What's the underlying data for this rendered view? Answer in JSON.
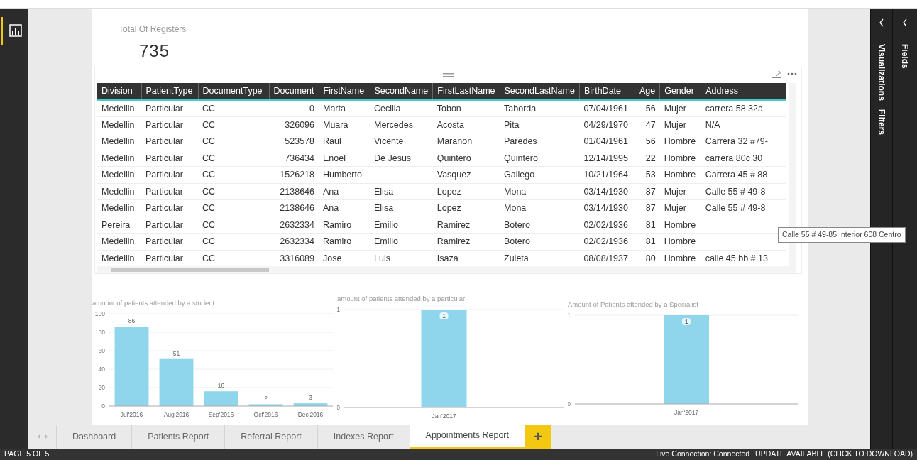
{
  "card": {
    "label": "Total Of Registers",
    "value": "735"
  },
  "table": {
    "columns": [
      "Division",
      "PatientType",
      "DocumentType",
      "Document",
      "FirstName",
      "SecondName",
      "FirstLastName",
      "SecondLastName",
      "BirthDate",
      "Age",
      "Gender",
      "Address"
    ],
    "rows": [
      [
        "Medellin",
        "Particular",
        "CC",
        "0",
        "Marta",
        "Cecilia",
        "Tobon",
        "Taborda",
        "07/04/1961",
        "56",
        "Mujer",
        "carrera 58 32a"
      ],
      [
        "Medellin",
        "Particular",
        "CC",
        "326096",
        "Muara",
        "Mercedes",
        "Acosta",
        "Pita",
        "04/29/1970",
        "47",
        "Mujer",
        "N/A"
      ],
      [
        "Medellin",
        "Particular",
        "CC",
        "523578",
        "Raul",
        "Vicente",
        "Marañon",
        "Paredes",
        "01/04/1961",
        "56",
        "Hombre",
        "Carrera 32 #79-"
      ],
      [
        "Medellin",
        "Particular",
        "CC",
        "736434",
        "Enoel",
        "De Jesus",
        "Quintero",
        "Quintero",
        "12/14/1995",
        "22",
        "Hombre",
        "carrera 80c 30"
      ],
      [
        "Medellin",
        "Particular",
        "CC",
        "1526218",
        "Humberto",
        "",
        "Vasquez",
        "Gallego",
        "10/21/1964",
        "53",
        "Hombre",
        "Carrera 45 # 88"
      ],
      [
        "Medellin",
        "Particular",
        "CC",
        "2138646",
        "Ana",
        "Elisa",
        "Lopez",
        "Mona",
        "03/14/1930",
        "87",
        "Mujer",
        "Calle 55 # 49-8"
      ],
      [
        "Medellin",
        "Particular",
        "CC",
        "2138646",
        "Ana",
        "Elisa",
        "Lopez",
        "Mona",
        "03/14/1930",
        "87",
        "Mujer",
        "Calle 55 # 49-8"
      ],
      [
        "Pereira",
        "Particular",
        "CC",
        "2632334",
        "Ramiro",
        "Emilio",
        "Ramirez",
        "Botero",
        "02/02/1936",
        "81",
        "Hombre",
        ""
      ],
      [
        "Medellin",
        "Particular",
        "CC",
        "2632334",
        "Ramiro",
        "Emilio",
        "Ramirez",
        "Botero",
        "02/02/1936",
        "81",
        "Hombre",
        ""
      ],
      [
        "Medellin",
        "Particular",
        "CC",
        "3316089",
        "Jose",
        "Luis",
        "Isaza",
        "Zuleta",
        "08/08/1937",
        "80",
        "Hombre",
        "calle 45 bb # 13"
      ]
    ]
  },
  "tooltip": "Calle 55 # 49-85 Interior 608 Centro",
  "charts": [
    {
      "chart_data": {
        "type": "bar",
        "title": "amount of patients attended by a student",
        "categories": [
          "Jul'2016",
          "Aug'2016",
          "Sep'2016",
          "Oct'2016",
          "Dec'2016"
        ],
        "series": [
          {
            "color": "#8fd6ec",
            "values": [
              86,
              51,
              16,
              2,
              3
            ]
          }
        ],
        "ylim": [
          0,
          100
        ],
        "yticks": [
          0,
          20,
          40,
          60,
          80,
          100
        ],
        "grid": true,
        "data_labels": true
      }
    },
    {
      "chart_data": {
        "type": "bar",
        "title": "amount of patients attended by a particular",
        "categories": [
          "Jan'2017"
        ],
        "series": [
          {
            "color": "#8fd6ec",
            "values": [
              1
            ]
          }
        ],
        "ylim": [
          0,
          1
        ],
        "yticks": [
          0,
          1
        ],
        "grid": true,
        "data_labels": true
      }
    },
    {
      "chart_data": {
        "type": "bar",
        "title": "Amount of Patients attended by a Specialist",
        "categories": [
          "Jan'2017"
        ],
        "series": [
          {
            "color": "#8fd6ec",
            "values": [
              1
            ]
          }
        ],
        "ylim": [
          0,
          1
        ],
        "yticks": [
          0,
          1
        ],
        "grid": true,
        "data_labels": true
      }
    }
  ],
  "side_panes": [
    {
      "label": "Visualizations"
    },
    {
      "label": "Filters"
    },
    {
      "label": "Fields"
    }
  ],
  "tabs": [
    {
      "label": "Dashboard",
      "selected": false
    },
    {
      "label": "Patients Report",
      "selected": false
    },
    {
      "label": "Referral Report",
      "selected": false
    },
    {
      "label": "Indexes Report",
      "selected": false
    },
    {
      "label": "Appointments Report",
      "selected": true
    }
  ],
  "add_tab": "+",
  "status_bar": {
    "page": "PAGE 5 OF 5",
    "connection": "Live Connection: Connected",
    "update": "UPDATE AVAILABLE (CLICK TO DOWNLOAD)"
  }
}
